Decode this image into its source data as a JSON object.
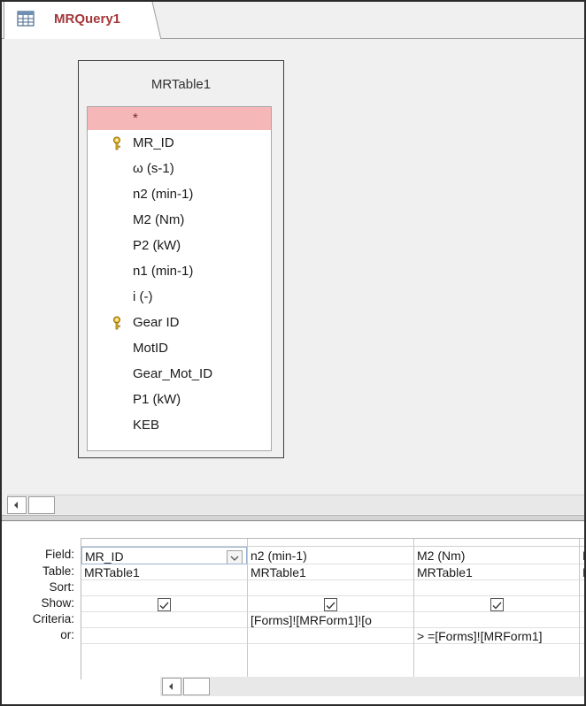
{
  "tab": {
    "label": "MRQuery1",
    "icon": "query-icon"
  },
  "table": {
    "title": "MRTable1",
    "fields": [
      {
        "label": "*",
        "key": false
      },
      {
        "label": "MR_ID",
        "key": true
      },
      {
        "label": "ω (s-1)",
        "key": false
      },
      {
        "label": "n2 (min-1)",
        "key": false
      },
      {
        "label": "M2 (Nm)",
        "key": false
      },
      {
        "label": "P2 (kW)",
        "key": false
      },
      {
        "label": "n1 (min-1)",
        "key": false
      },
      {
        "label": "i (-)",
        "key": false
      },
      {
        "label": "Gear ID",
        "key": true
      },
      {
        "label": "MotID",
        "key": false
      },
      {
        "label": "Gear_Mot_ID",
        "key": false
      },
      {
        "label": "P1 (kW)",
        "key": false
      },
      {
        "label": "KEB",
        "key": false
      }
    ]
  },
  "grid": {
    "row_labels": {
      "field": "Field:",
      "table": "Table:",
      "sort": "Sort:",
      "show": "Show:",
      "criteria": "Criteria:",
      "or": "or:"
    },
    "columns": [
      {
        "field": "MR_ID",
        "table": "MRTable1",
        "sort": "",
        "show": true,
        "criteria": "",
        "or": ""
      },
      {
        "field": "n2 (min-1)",
        "table": "MRTable1",
        "sort": "",
        "show": true,
        "criteria": "[Forms]![MRForm1]![o",
        "or": ""
      },
      {
        "field": "M2 (Nm)",
        "table": "MRTable1",
        "sort": "",
        "show": true,
        "criteria": "",
        "or": "> =[Forms]![MRForm1]"
      },
      {
        "field": "P",
        "table": "M",
        "sort": "",
        "show": false,
        "criteria": "",
        "or": ""
      }
    ]
  },
  "colors": {
    "accent": "#a4373a",
    "selected_row": "#f5b7b8"
  }
}
